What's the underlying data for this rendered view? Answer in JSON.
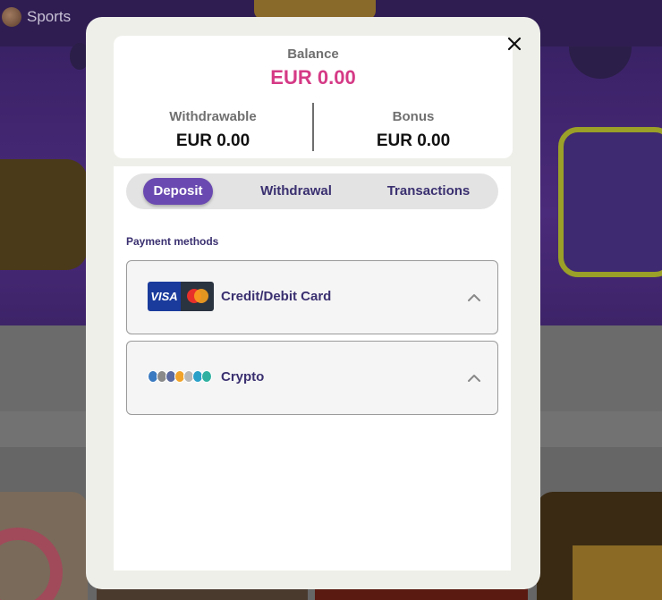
{
  "background": {
    "nav_sports_label": "Sports"
  },
  "modal": {
    "balance": {
      "label": "Balance",
      "value": "EUR 0.00",
      "withdrawable_label": "Withdrawable",
      "withdrawable_value": "EUR 0.00",
      "bonus_label": "Bonus",
      "bonus_value": "EUR 0.00"
    },
    "tabs": [
      {
        "label": "Deposit",
        "active": true
      },
      {
        "label": "Withdrawal",
        "active": false
      },
      {
        "label": "Transactions",
        "active": false
      }
    ],
    "payment_methods_title": "Payment methods",
    "payment_methods": [
      {
        "label": "Credit/Debit Card",
        "icon": "visa-mastercard-icon"
      },
      {
        "label": "Crypto",
        "icon": "crypto-coins-icon"
      }
    ],
    "card_logo_text": "VISA"
  },
  "colors": {
    "accent_purple": "#6a4ab0",
    "balance_pink": "#d53a86",
    "text_purple": "#3a3070"
  }
}
